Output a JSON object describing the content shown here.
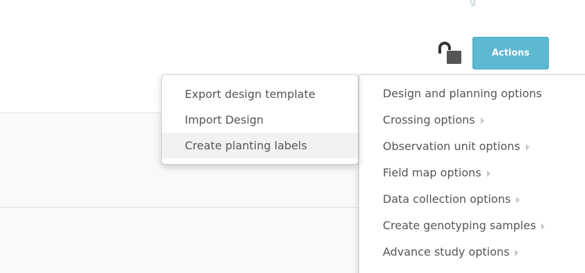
{
  "header": {
    "clipped_text": "g",
    "lock_icon": "unlocked-padlock-icon",
    "actions_label": "Actions",
    "accent_color": "#5db8d2"
  },
  "actions_menu": {
    "items": [
      {
        "label": "Design and planning options",
        "has_submenu": false
      },
      {
        "label": "Crossing options",
        "has_submenu": true
      },
      {
        "label": "Observation unit options",
        "has_submenu": true
      },
      {
        "label": "Field map options",
        "has_submenu": true
      },
      {
        "label": "Data collection options",
        "has_submenu": true
      },
      {
        "label": "Create genotyping samples",
        "has_submenu": true
      },
      {
        "label": "Advance study options",
        "has_submenu": true
      }
    ]
  },
  "design_submenu": {
    "items": [
      {
        "label": "Export design template"
      },
      {
        "label": "Import Design"
      },
      {
        "label": "Create planting labels",
        "hovered": true
      }
    ]
  }
}
